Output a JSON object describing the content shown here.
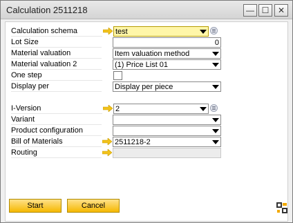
{
  "window": {
    "title": "Calculation 2511218",
    "minimize_glyph": "—",
    "maximize_glyph": "☐",
    "close_glyph": "✕"
  },
  "form": {
    "calculation_schema": {
      "label": "Calculation schema",
      "value": "test"
    },
    "lot_size": {
      "label": "Lot Size",
      "value": "0"
    },
    "material_valuation": {
      "label": "Material valuation",
      "value": "Item valuation method"
    },
    "material_valuation_2": {
      "label": "Material valuation 2",
      "value": "(1) Price List 01"
    },
    "one_step": {
      "label": "One step",
      "checked": false
    },
    "display_per": {
      "label": "Display per",
      "value": "Display per piece"
    },
    "i_version": {
      "label": "I-Version",
      "value": "2"
    },
    "variant": {
      "label": "Variant",
      "value": ""
    },
    "product_configuration": {
      "label": "Product configuration",
      "value": ""
    },
    "bill_of_materials": {
      "label": "Bill of Materials",
      "value": "2511218-2"
    },
    "routing": {
      "label": "Routing",
      "value": ""
    }
  },
  "buttons": {
    "start": "Start",
    "cancel": "Cancel"
  },
  "colors": {
    "required_field": "#fff6a8",
    "button_gold": "#f5b800",
    "link_arrow": "#f2c21b"
  }
}
